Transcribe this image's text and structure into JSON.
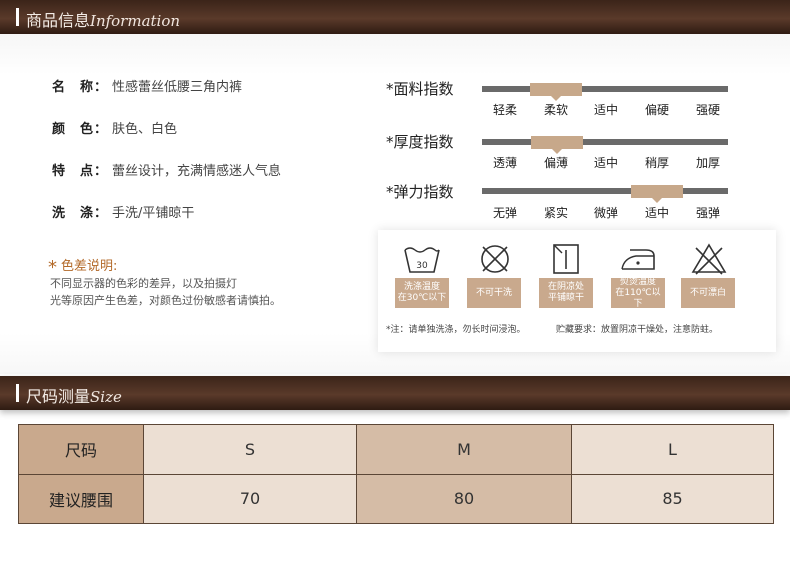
{
  "product_info": {
    "title_cn": "商品信息",
    "title_en": "Information",
    "specs": [
      {
        "label": "名　称：",
        "value": "性感蕾丝低腰三角内裤"
      },
      {
        "label": "颜　色：",
        "value": "肤色、白色"
      },
      {
        "label": "特　点：",
        "value": "蕾丝设计，充满情感迷人气息"
      },
      {
        "label": "洗　涤：",
        "value": "手洗/平铺晾干"
      }
    ],
    "color_note": {
      "title": "色差说明:",
      "lines": [
        "不同显示器的色彩的差异，以及拍摄灯",
        "光等原因产生色差，对颜色过份敏感者请慎拍。"
      ]
    }
  },
  "scales": [
    {
      "title": "*面料指数",
      "labels": [
        "轻柔",
        "柔软",
        "适中",
        "偏硬",
        "强硬"
      ],
      "selected_index": 1,
      "selected": "柔软"
    },
    {
      "title": "*厚度指数",
      "labels": [
        "透薄",
        "偏薄",
        "适中",
        "稍厚",
        "加厚"
      ],
      "selected_index": 1,
      "selected": "偏薄"
    },
    {
      "title": "*弹力指数",
      "labels": [
        "无弹",
        "紧实",
        "微弹",
        "适中",
        "强弹"
      ],
      "selected_index": 3,
      "selected": "适中"
    }
  ],
  "care": {
    "icons": [
      "wash-30-icon",
      "no-dry-clean-icon",
      "shade-dry-icon",
      "iron-low-icon",
      "no-bleach-icon"
    ],
    "tags": [
      [
        "洗涤温度",
        "在30℃以下"
      ],
      [
        "不可干洗"
      ],
      [
        "在阴凉处",
        "平铺晾干"
      ],
      [
        "熨烫温度",
        "在110℃以下"
      ],
      [
        "不可漂白"
      ]
    ],
    "wash_symbol_text": "30",
    "note_left": "*注：请单独洗涤，勿长时间浸泡。",
    "note_right": "贮藏要求：放置阴凉干燥处，注意防蛀。"
  },
  "size_section": {
    "title_cn": "尺码测量",
    "title_en": "Size",
    "header": [
      "尺码",
      "S",
      "M",
      "L"
    ],
    "row": [
      "建议腰围",
      "70",
      "80",
      "85"
    ]
  },
  "colors": {
    "bar_dark": "#3b2419",
    "accent_tan": "#c9a98d",
    "note_orange": "#b36a2a"
  }
}
